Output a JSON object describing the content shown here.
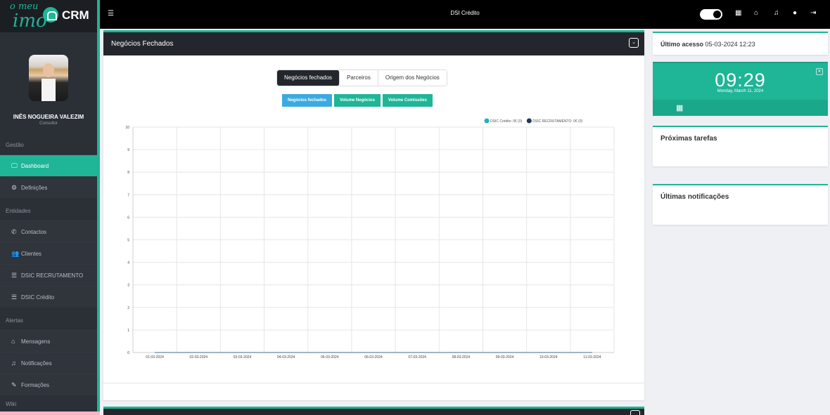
{
  "brand": {
    "logo_small": "o meu",
    "logo_big": "imo",
    "crm": "CRM"
  },
  "user": {
    "name": "INÊS NOGUEIRA VALEZIM",
    "role": "Consultor"
  },
  "sidebar": {
    "sections": [
      {
        "title": "Gestão",
        "items": [
          {
            "label": "Dashboard",
            "icon": "monitor-icon",
            "glyph": "🖵",
            "active": true
          },
          {
            "label": "Definições",
            "icon": "gear-icon",
            "glyph": "⚙",
            "active": false
          }
        ]
      },
      {
        "title": "Entidades",
        "items": [
          {
            "label": "Contactos",
            "icon": "phone-icon",
            "glyph": "✆",
            "active": false
          },
          {
            "label": "Clientes",
            "icon": "users-icon",
            "glyph": "👥",
            "active": false
          },
          {
            "label": "DSIC RECRUTAMENTO",
            "icon": "list-icon",
            "glyph": "☰",
            "active": false
          },
          {
            "label": "DSIC Crédito",
            "icon": "list-icon",
            "glyph": "☰",
            "active": false
          }
        ]
      },
      {
        "title": "Alertas",
        "items": [
          {
            "label": "Mensagens",
            "icon": "inbox-icon",
            "glyph": "⌂",
            "active": false
          },
          {
            "label": "Notificações",
            "icon": "bell-icon",
            "glyph": "♫",
            "active": false
          },
          {
            "label": "Formações",
            "icon": "pencil-icon",
            "glyph": "✎",
            "active": false
          }
        ]
      }
    ],
    "wiki": "Wiki"
  },
  "topbar": {
    "title": "DSI Crédito"
  },
  "panel": {
    "title": "Negócios Fechados",
    "tabs": [
      {
        "label": "Negócios fechados",
        "active": true
      },
      {
        "label": "Parceiros",
        "active": false
      },
      {
        "label": "Origem dos Negócios",
        "active": false
      }
    ],
    "subtabs": [
      {
        "label": "Negócios fechados",
        "active": true
      },
      {
        "label": "Volume Negócios",
        "active": false
      },
      {
        "label": "Volume Comissões",
        "active": false
      }
    ]
  },
  "chart_data": {
    "type": "line",
    "categories": [
      "01-03-2024",
      "02-03-2024",
      "03-03-2024",
      "04-03-2024",
      "05-03-2024",
      "06-03-2024",
      "07-03-2024",
      "08-03-2024",
      "09-03-2024",
      "10-03-2024",
      "11-03-2024"
    ],
    "ylim": [
      0,
      10
    ],
    "yticks": [
      "0",
      "1",
      "2",
      "3",
      "4",
      "5",
      "6",
      "7",
      "8",
      "9",
      "10"
    ],
    "legend_position": "top-right",
    "grid": true,
    "series": [
      {
        "name": "DSIC Crédito: 0€ (0)",
        "color": "#1eb3c4",
        "values": [
          0,
          0,
          0,
          0,
          0,
          0,
          0,
          0,
          0,
          0,
          0
        ]
      },
      {
        "name": "DSIC RECRUTAMENTO: 0€ (0)",
        "color": "#1f3a5a",
        "values": [
          0,
          0,
          0,
          0,
          0,
          0,
          0,
          0,
          0,
          0,
          0
        ]
      }
    ]
  },
  "right": {
    "last_access_label": "Último acesso",
    "last_access_value": "05-03-2024 12:23",
    "clock_time": "09:29",
    "clock_date": "Monday, March 11, 2024",
    "tasks_title": "Próximas tarefas",
    "notifications_title": "Últimas notificações"
  },
  "colors": {
    "accent": "#1fb597",
    "dark": "#23272d",
    "sidebar": "#2b2f36",
    "subtab_active": "#3aaae0"
  }
}
